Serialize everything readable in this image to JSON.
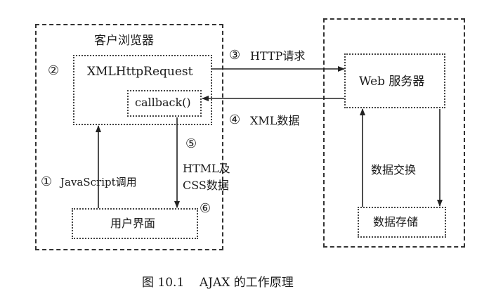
{
  "client": {
    "title": "客户浏览器",
    "num_xhr": "②",
    "xhr_label": "XMLHttpRequest",
    "callback_label": "callback()",
    "ui_label": "用户界面",
    "num_js": "①",
    "js_label": "JavaScript调用",
    "num_html": "⑤",
    "html_label_1": "HTML及",
    "html_label_2": "CSS数据",
    "num_ui": "⑥"
  },
  "middle": {
    "num_http": "③",
    "http_label": "HTTP请求",
    "num_xml": "④",
    "xml_label": "XML数据"
  },
  "server": {
    "web_label": "Web 服务器",
    "exchange_label": "数据交换",
    "storage_label": "数据存储"
  },
  "caption": "图 10.1    AJAX 的工作原理"
}
